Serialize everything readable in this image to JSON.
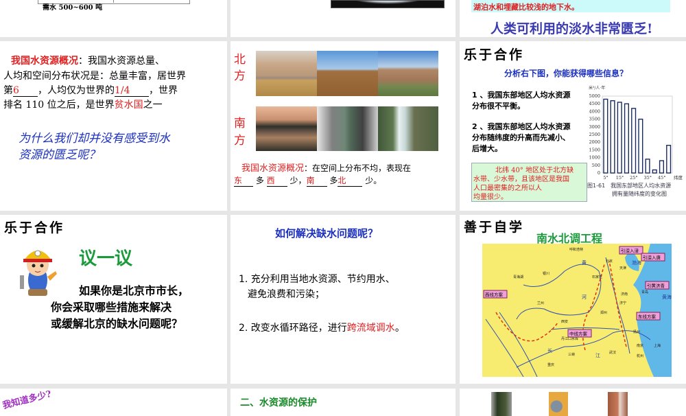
{
  "top_row": {
    "slide1": {
      "caption": "需水 500~600 吨"
    },
    "slide3": {
      "highlight_text": "湖泊水和埋藏比较浅的地下水。",
      "headline": "人类可利用的淡水非常匮乏!"
    }
  },
  "slide_overview": {
    "title": "我国水资源概况",
    "line1_rest": "：我国水资源总量、",
    "line2": "人均和空间分布状况是：总量丰富，居世界",
    "line3_a": "第",
    "rank_answer": "6",
    "line3_b": "，人均仅为世界的",
    "fraction_answer": "1/4",
    "line3_c": "，世界",
    "line4_a": "排名 110 位之后，是世界",
    "poor_answer": "贫水国",
    "line4_b": "之一",
    "question_line1": "为什么我们却并没有感受到水",
    "question_line2": "资源的匮乏呢？"
  },
  "slide_regions": {
    "north_label": [
      "北",
      "方"
    ],
    "south_label": [
      "南",
      "方"
    ],
    "title": "我国水资源概况",
    "text_a": "：在空间上分布不均，表现在",
    "ans1": "东",
    "mid1": "多",
    "ans2": "西",
    "mid2": "少，",
    "ans3": "南",
    "mid3": "多",
    "ans4": "北",
    "end": "少。"
  },
  "slide_chart": {
    "heading": "乐于合作",
    "subtitle": "分析右下图，你能获得哪些信息？",
    "point1_line1": "1 、我国东部地区人均水资源",
    "point1_line2": "分布很不平衡。",
    "point2_line1": "2 、我国东部地区人均水资源",
    "point2_line2": "分布随纬度的升高而先减小、",
    "point2_line3": "后增大。",
    "note_line1": "北纬 40° 地区处于北方缺",
    "note_line2": "水带、少水带，且该地区是我国",
    "note_line3": "人口最密集的之所以人",
    "note_line4": "均量很少。",
    "figure_caption_line1": "图1-61　我国东部地区人均水资源",
    "figure_caption_line2": "拥有量随纬度的变化图"
  },
  "chart_data": {
    "type": "bar",
    "title": "我国东部地区人均水资源拥有量随纬度的变化图",
    "ylabel": "米³/人·年",
    "xlabel": "纬度",
    "categories": [
      "5°",
      "10°",
      "15°",
      "20°",
      "25°",
      "30°",
      "35°",
      "40°",
      "45°",
      "50°"
    ],
    "values": [
      4800,
      4700,
      4600,
      4500,
      4200,
      3500,
      900,
      200,
      800,
      1800
    ],
    "ylim": [
      0,
      5000
    ],
    "yticks": [
      "0",
      "500",
      "1000",
      "1500",
      "2000",
      "2500",
      "3000",
      "3500",
      "4000",
      "4500",
      "5000"
    ],
    "xticks": [
      "5°",
      "15°",
      "25°",
      "35°",
      "45°"
    ],
    "grid": false
  },
  "slide_discuss": {
    "heading": "乐于合作",
    "title": "议一议",
    "line1": "如果你是北京市市长，",
    "line2": "你会采取哪些措施来解决",
    "line3": "或缓解北京的缺水问题呢？"
  },
  "slide_solutions": {
    "title": "如何解决缺水问题呢？",
    "item1_line1": "1. 充分利用当地水资源、节约用水、",
    "item1_line2": "避免浪费和污染；",
    "item2_a": "2. 改变水循环路径，进行",
    "item2_red": "跨流域调水",
    "item2_end": "。"
  },
  "slide_map": {
    "heading": "善于自学",
    "title": "南水北调工程",
    "labels": [
      "引滦入津",
      "引滦入唐",
      "引黄济青",
      "西线方案",
      "东线方案",
      "中线方案"
    ],
    "places": [
      "呼和浩特",
      "北京",
      "天津",
      "银川",
      "石家庄",
      "青海湖",
      "济南",
      "青岛",
      "兰州",
      "济宁",
      "郑州",
      "西安",
      "扬州",
      "丹江口水库",
      "南京",
      "上海",
      "武汉",
      "杭州",
      "重庆",
      "三峡"
    ],
    "water": [
      "黄",
      "渤海",
      "黄海",
      "河",
      "长",
      "江"
    ]
  },
  "bottom_row": {
    "slide1_title": "我知道多少?",
    "slide2_title": "二、水资源的保护"
  },
  "colors": {
    "red": "#e02020",
    "blue": "#1a2fc0",
    "green": "#1a9a3a",
    "purple": "#a030c0",
    "background": "#e6e6e6"
  }
}
